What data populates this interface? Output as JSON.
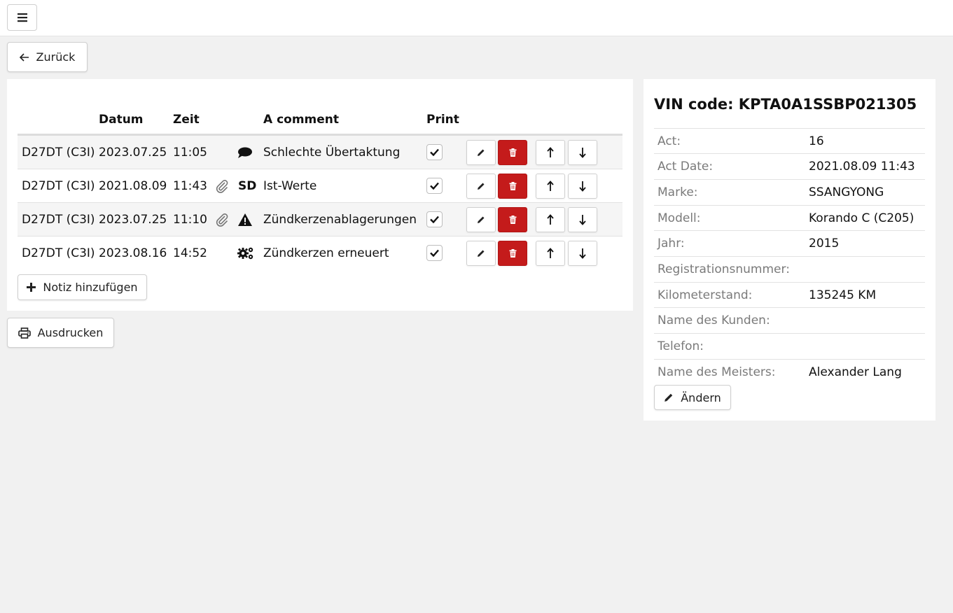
{
  "topbar": {
    "menu_icon": "hamburger-icon"
  },
  "back_button": {
    "label": "Zurück",
    "icon": "arrow-left-icon"
  },
  "notes": {
    "columns": {
      "col1": "",
      "date": "Datum",
      "time": "Zeit",
      "comment": "A comment",
      "print": "Print"
    },
    "rows": [
      {
        "code": "D27DT (C3I)",
        "date": "2023.07.25",
        "time": "11:05",
        "attachment": false,
        "type_icon": "comment-icon",
        "type_text": "",
        "comment": "Schlechte Übertaktung",
        "print": true
      },
      {
        "code": "D27DT (C3I)",
        "date": "2021.08.09",
        "time": "11:43",
        "attachment": true,
        "type_icon": "",
        "type_text": "SD",
        "comment": "Ist-Werte",
        "print": true
      },
      {
        "code": "D27DT (C3I)",
        "date": "2023.07.25",
        "time": "11:10",
        "attachment": true,
        "type_icon": "warning-icon",
        "type_text": "",
        "comment": "Zündkerzenablagerungen",
        "print": true
      },
      {
        "code": "D27DT (C3I)",
        "date": "2023.08.16",
        "time": "14:52",
        "attachment": false,
        "type_icon": "gears-icon",
        "type_text": "",
        "comment": "Zündkerzen erneuert",
        "print": true
      }
    ],
    "add_label": "Notiz hinzufügen"
  },
  "print_button": {
    "label": "Ausdrucken",
    "icon": "printer-icon"
  },
  "vehicle": {
    "vin_title": "VIN code: KPTA0A1SSBP021305",
    "fields": [
      {
        "label": "Act:",
        "value": "16"
      },
      {
        "label": "Act Date:",
        "value": "2021.08.09 11:43"
      },
      {
        "label": "Marke:",
        "value": "SSANGYONG"
      },
      {
        "label": "Modell:",
        "value": "Korando C (C205)"
      },
      {
        "label": "Jahr:",
        "value": "2015"
      },
      {
        "label": "Registrationsnummer:",
        "value": ""
      },
      {
        "label": "Kilometerstand:",
        "value": "135245 KM"
      },
      {
        "label": "Name des Kunden:",
        "value": ""
      },
      {
        "label": "Telefon:",
        "value": ""
      },
      {
        "label": "Name des Meisters:",
        "value": "Alexander Lang"
      }
    ],
    "edit_label": "Ändern"
  },
  "colors": {
    "danger": "#c41b1b",
    "border": "#cfcfcf",
    "background": "#f1f1f1"
  }
}
